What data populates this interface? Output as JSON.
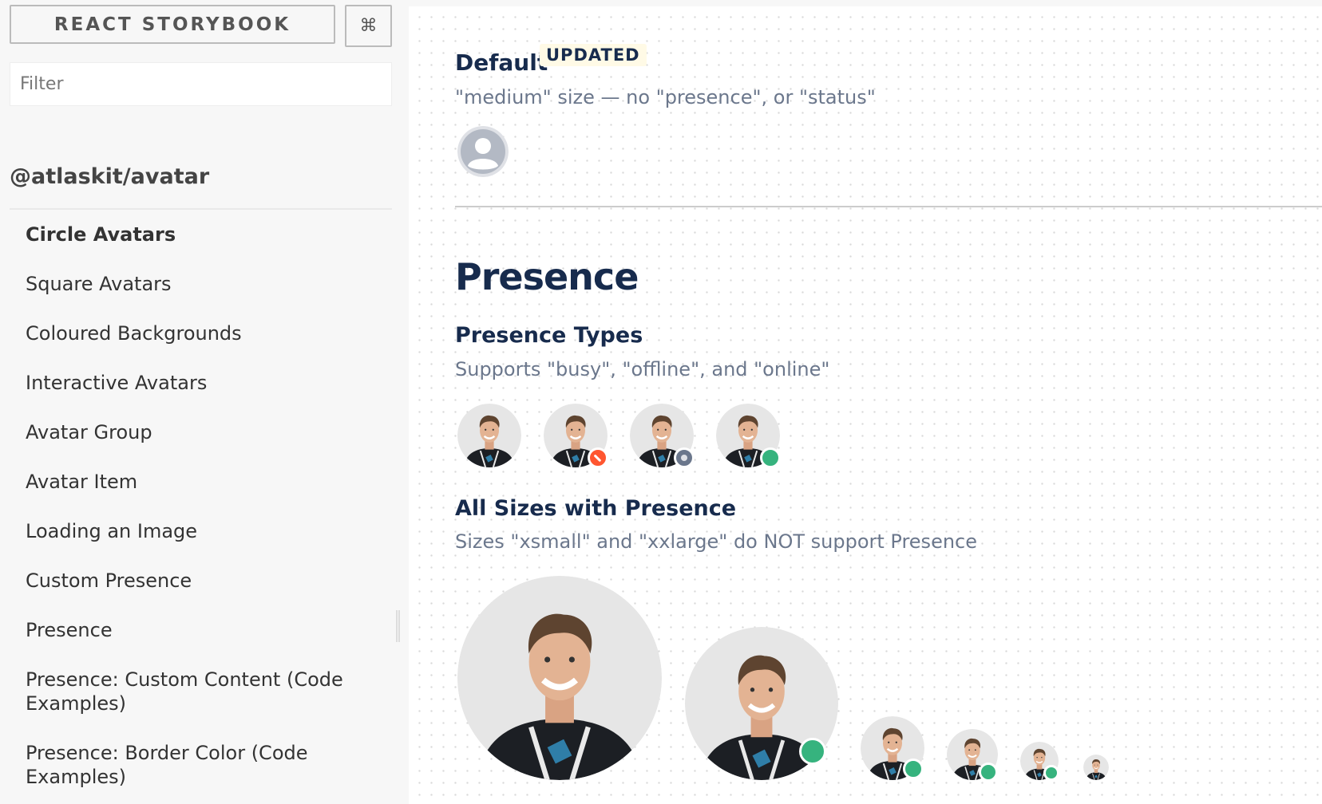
{
  "sidebar": {
    "title": "REACT STORYBOOK",
    "shortcut_icon": "⌘",
    "filter_placeholder": "Filter",
    "kind": "@atlaskit/avatar",
    "items": [
      {
        "label": "Circle Avatars",
        "active": true
      },
      {
        "label": "Square Avatars"
      },
      {
        "label": "Coloured Backgrounds"
      },
      {
        "label": "Interactive Avatars"
      },
      {
        "label": "Avatar Group"
      },
      {
        "label": "Avatar Item"
      },
      {
        "label": "Loading an Image"
      },
      {
        "label": "Custom Presence"
      },
      {
        "label": "Presence"
      },
      {
        "label": "Presence: Custom Content (Code Examples)"
      },
      {
        "label": "Presence: Border Color (Code Examples)"
      }
    ]
  },
  "story": {
    "default": {
      "title": "Default",
      "badge": "UPDATED",
      "description": "\"medium\" size — no \"presence\", or \"status\""
    },
    "presence": {
      "title": "Presence",
      "types": {
        "title": "Presence Types",
        "description": "Supports \"busy\", \"offline\", and \"online\"",
        "items": [
          "none",
          "busy",
          "offline",
          "online"
        ]
      },
      "sizes": {
        "title": "All Sizes with Presence",
        "description": "Sizes \"xsmall\" and \"xxlarge\" do NOT support Presence",
        "items": [
          "xxlarge",
          "xlarge",
          "large",
          "medium",
          "small",
          "xsmall"
        ]
      }
    }
  },
  "colors": {
    "heading": "#172B4D",
    "subtle": "#6B778C",
    "busy": "#FF5630",
    "offline": "#6B778C",
    "online": "#36B37E"
  }
}
